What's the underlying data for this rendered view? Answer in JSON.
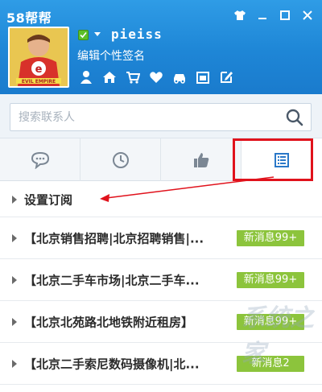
{
  "window": {
    "title": "58帮帮"
  },
  "profile": {
    "username": "pieiss",
    "signature": "编辑个性签名",
    "avatar_shirt_letter": "e",
    "avatar_shirt_text": "EVIL EMPIRE"
  },
  "search": {
    "placeholder": "搜索联系人"
  },
  "tabs": [
    {
      "icon": "chat-bubble-icon",
      "active": false
    },
    {
      "icon": "clock-icon",
      "active": false
    },
    {
      "icon": "thumbs-up-icon",
      "active": false
    },
    {
      "icon": "list-icon",
      "active": true
    }
  ],
  "list": {
    "header": "设置订阅",
    "items": [
      {
        "label": "【北京销售招聘|北京招聘销售|...",
        "badge": "新消息99+"
      },
      {
        "label": "【北京二手车市场|北京二手车...",
        "badge": "新消息99+"
      },
      {
        "label": "【北京北苑路北地铁附近租房】",
        "badge": "新消息99+"
      },
      {
        "label": "【北京二手索尼数码摄像机|北...",
        "badge": "新消息2"
      }
    ]
  },
  "watermark": "系统之家",
  "colors": {
    "header_blue": "#1e86d6",
    "badge_green": "#8cc43c",
    "annotation_red": "#e0121c"
  }
}
